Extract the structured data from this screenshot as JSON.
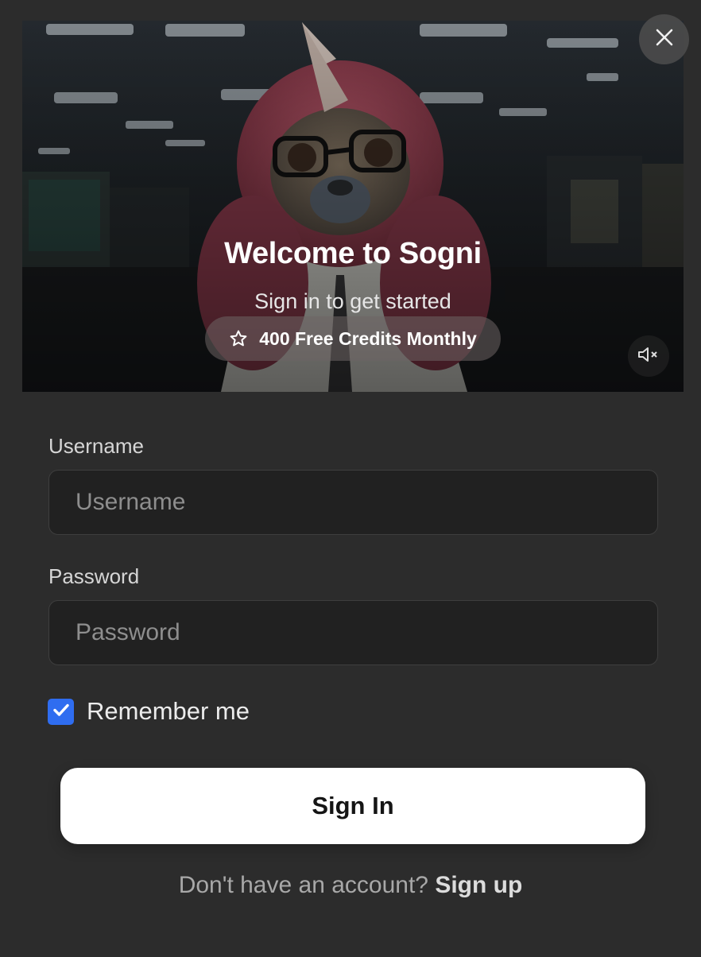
{
  "hero": {
    "title": "Welcome to Sogni",
    "subtitle": "Sign in to get started",
    "badge_label": "400 Free Credits Monthly",
    "badge_icon": "star-icon",
    "mute_icon": "speaker-muted-icon",
    "image_description_icon": "pink-unicorn-sloth-mascot"
  },
  "close_icon": "close-icon",
  "form": {
    "username": {
      "label": "Username",
      "placeholder": "Username",
      "value": ""
    },
    "password": {
      "label": "Password",
      "placeholder": "Password",
      "value": ""
    },
    "remember": {
      "label": "Remember me",
      "checked": true
    },
    "submit_label": "Sign In"
  },
  "footer": {
    "prompt": "Don't have an account?",
    "link_label": "Sign up"
  },
  "colors": {
    "background": "#2c2c2c",
    "input_background": "#212121",
    "checkbox_accent": "#2f6df0",
    "button_background": "#ffffff"
  }
}
